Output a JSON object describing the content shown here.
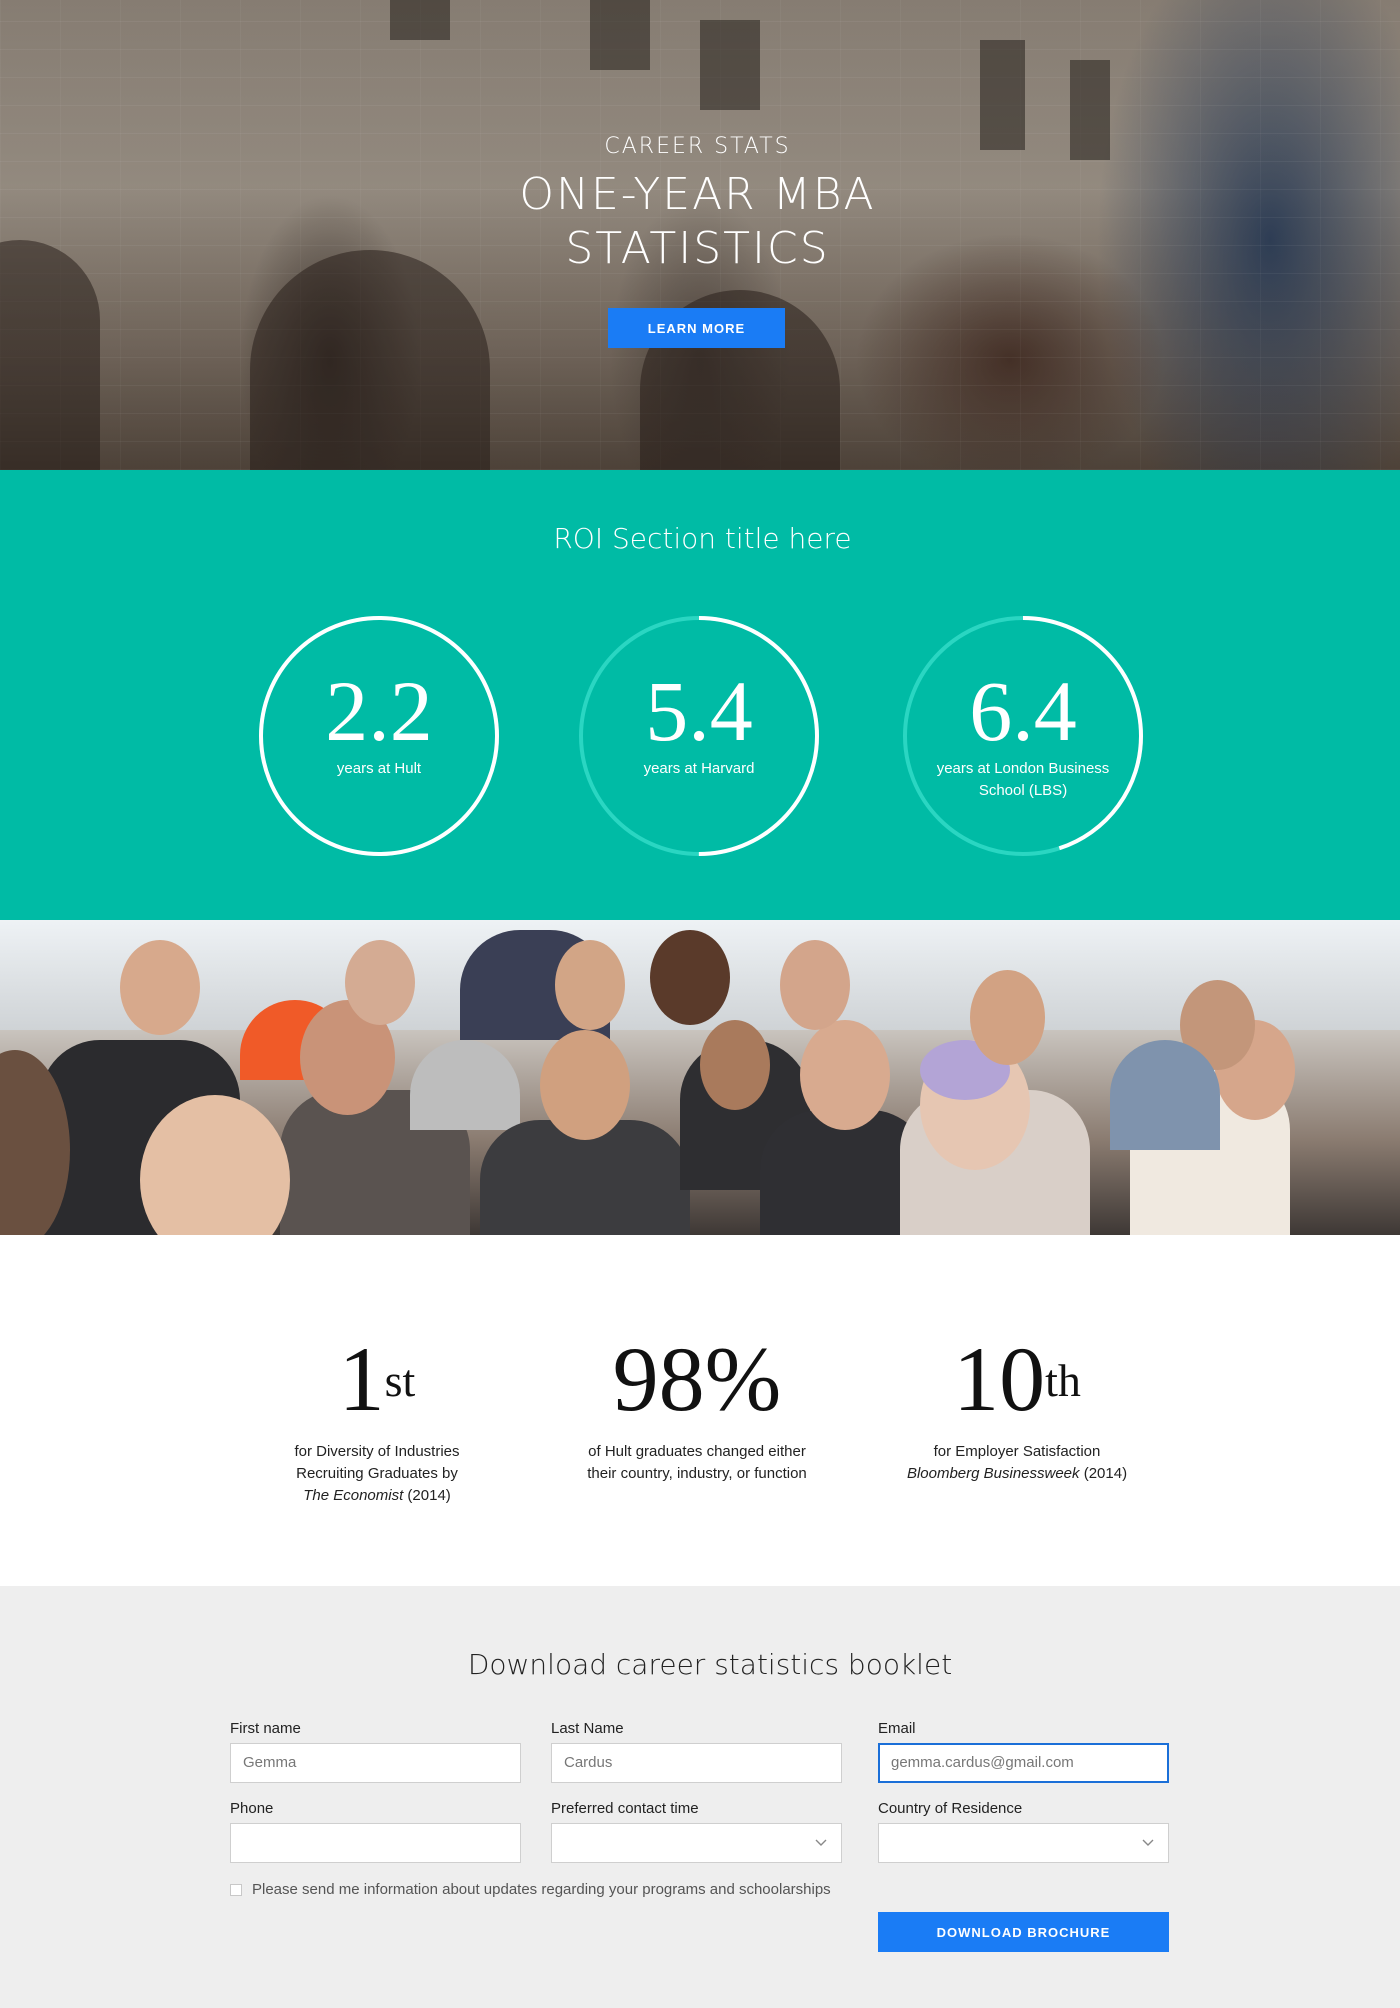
{
  "hero": {
    "kicker": "CAREER STATS",
    "title_line1": "ONE-YEAR MBA",
    "title_line2": "STATISTICS",
    "cta": "LEARN MORE"
  },
  "roi": {
    "title": "ROI Section title here",
    "items": [
      {
        "value": "2.2",
        "label": "years at Hult",
        "progress": 1.0
      },
      {
        "value": "5.4",
        "label": "years at Harvard",
        "progress": 0.5
      },
      {
        "value": "6.4",
        "label": "years at London Business School (LBS)",
        "progress": 0.45
      }
    ],
    "colors": {
      "ring_fill": "#ffffff",
      "ring_track": "#2ad6c2",
      "background": "#00bba5"
    }
  },
  "stats": [
    {
      "big": "1",
      "sup": "st",
      "line1": "for Diversity of Industries",
      "line2": "Recruiting Graduates by",
      "source_italic": "The Economist",
      "source_year": " (2014)"
    },
    {
      "big": "98%",
      "sup": "",
      "line1": "of Hult graduates changed either",
      "line2": "their country, industry, or function",
      "source_italic": "",
      "source_year": ""
    },
    {
      "big": "10",
      "sup": "th",
      "line1": "for Employer Satisfaction",
      "line2": "",
      "source_italic": "Bloomberg Businessweek",
      "source_year": " (2014)"
    }
  ],
  "form": {
    "title": "Download career statistics booklet",
    "first_name_label": "First name",
    "first_name_value": "Gemma",
    "last_name_label": "Last Name",
    "last_name_value": "Cardus",
    "email_label": "Email",
    "email_value": "gemma.cardus@gmail.com",
    "phone_label": "Phone",
    "phone_value": "",
    "contact_time_label": "Preferred contact time",
    "contact_time_value": "",
    "country_label": "Country of Residence",
    "country_value": "",
    "consent_label": "Please send me information about updates regarding your programs and schoolarships",
    "consent_checked": false,
    "submit": "DOWNLOAD BROCHURE"
  },
  "colors": {
    "accent_blue": "#1a7cf5",
    "teal": "#00bba5",
    "form_bg": "#eeeeee"
  }
}
